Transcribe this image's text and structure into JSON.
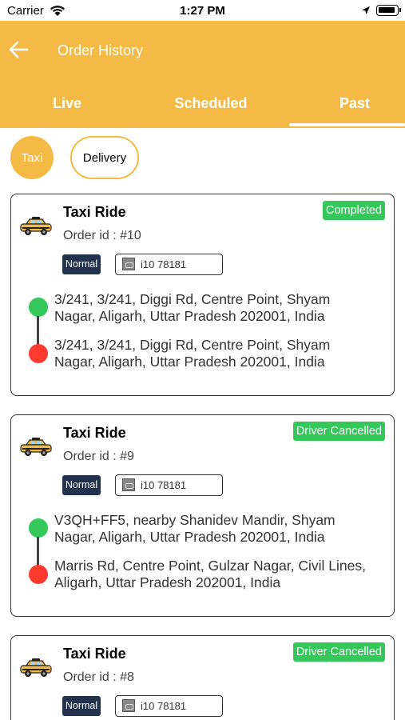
{
  "status_bar": {
    "carrier": "Carrier",
    "time": "1:27 PM"
  },
  "header": {
    "title": "Order History",
    "tabs": [
      {
        "label": "Live"
      },
      {
        "label": "Scheduled"
      },
      {
        "label": "Past",
        "selected": true
      }
    ]
  },
  "filters": [
    {
      "label": "Taxi",
      "selected": true
    },
    {
      "label": "Delivery",
      "selected": false
    }
  ],
  "orders": [
    {
      "title": "Taxi Ride",
      "order_id": "Order id : #10",
      "status": "Completed",
      "ride_type": "Normal",
      "vehicle": "i10 78181",
      "pickup": "3/241, 3/241, Diggi Rd, Centre Point, Shyam Nagar, Aligarh, Uttar Pradesh 202001, India",
      "drop": "3/241, 3/241, Diggi Rd, Centre Point, Shyam Nagar, Aligarh, Uttar Pradesh 202001, India"
    },
    {
      "title": "Taxi Ride",
      "order_id": "Order id : #9",
      "status": "Driver Cancelled",
      "ride_type": "Normal",
      "vehicle": "i10 78181",
      "pickup": "V3QH+FF5, nearby Shanidev Mandir, Shyam Nagar, Aligarh, Uttar Pradesh 202001, India",
      "drop": "Marris Rd, Centre Point, Gulzar Nagar, Civil Lines, Aligarh, Uttar Pradesh 202001, India"
    },
    {
      "title": "Taxi Ride",
      "order_id": "Order id : #8",
      "status": "Driver Cancelled",
      "ride_type": "Normal",
      "vehicle": "i10 78181"
    }
  ],
  "colors": {
    "accent": "#F5BA45",
    "status_green": "#34C759",
    "drop_red": "#FF3B30",
    "badge_navy": "#22324D"
  },
  "icons": {
    "back": "arrow-left-icon",
    "ride": "taxi-icon",
    "vehicle": "car-photo-icon",
    "pickup": "green-dot-icon",
    "drop": "red-dot-icon"
  }
}
